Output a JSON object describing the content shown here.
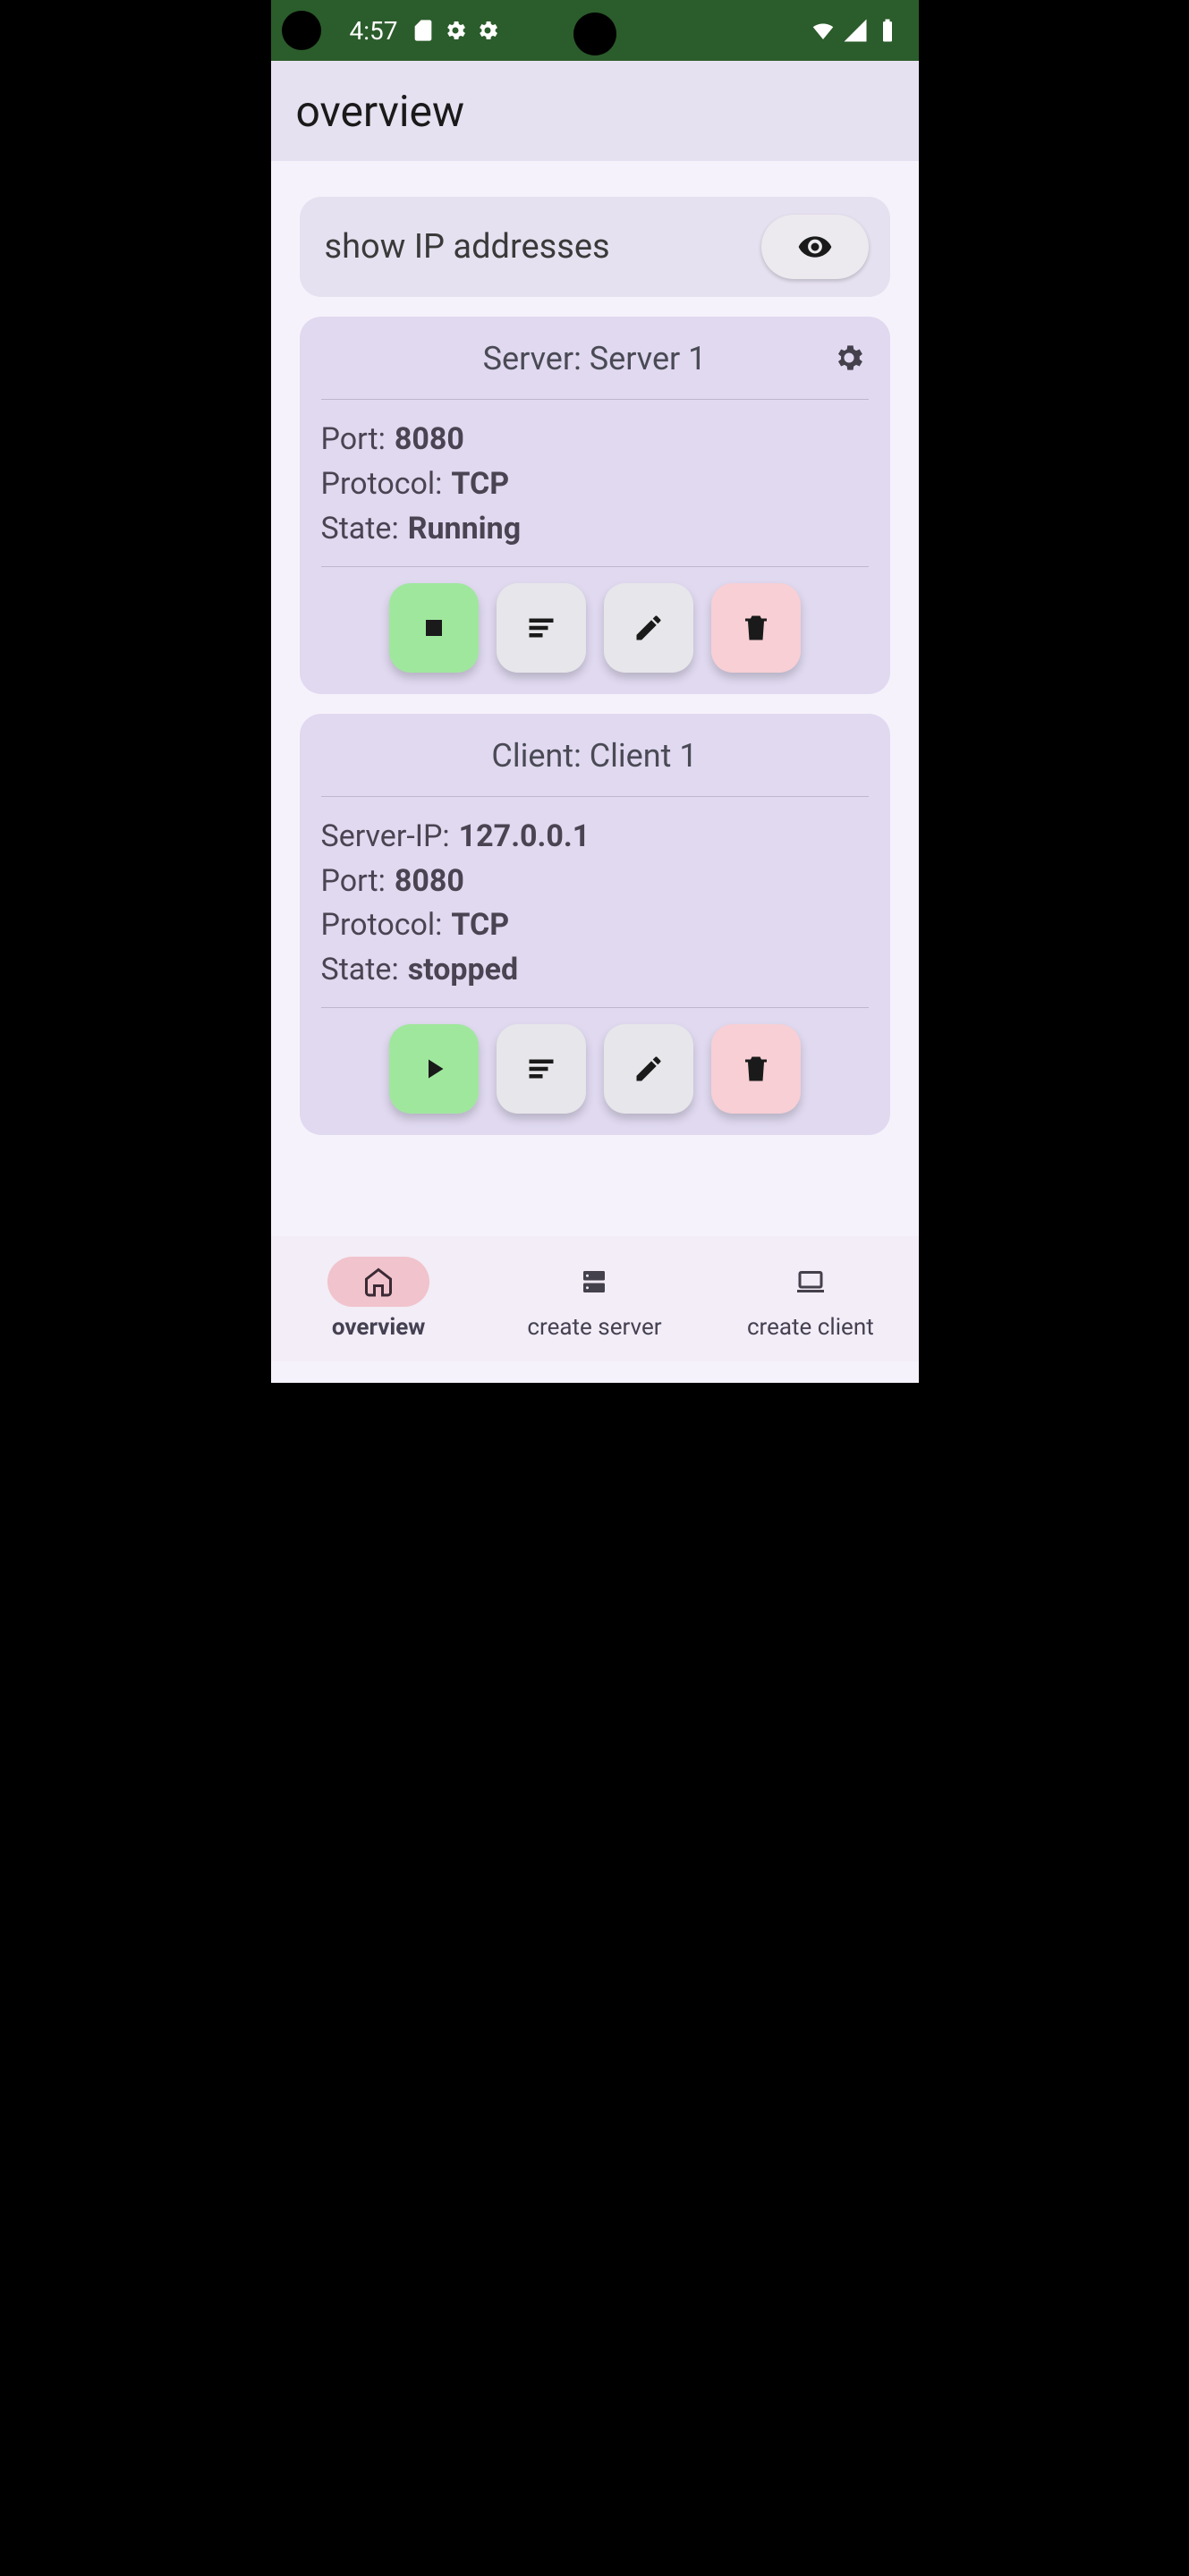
{
  "status_bar": {
    "time": "4:57"
  },
  "header": {
    "title": "overview"
  },
  "ip_card": {
    "label": "show IP addresses"
  },
  "server": {
    "title_prefix": "Server:",
    "name": "Server 1",
    "fields": {
      "port_label": "Port:",
      "port": "8080",
      "protocol_label": "Protocol:",
      "protocol": "TCP",
      "state_label": "State:",
      "state": "Running"
    }
  },
  "client": {
    "title_prefix": "Client:",
    "name": "Client 1",
    "fields": {
      "serverip_label": "Server-IP:",
      "serverip": "127.0.0.1",
      "port_label": "Port:",
      "port": "8080",
      "protocol_label": "Protocol:",
      "protocol": "TCP",
      "state_label": "State:",
      "state": "stopped"
    }
  },
  "nav": {
    "overview": "overview",
    "create_server": "create server",
    "create_client": "create client"
  }
}
